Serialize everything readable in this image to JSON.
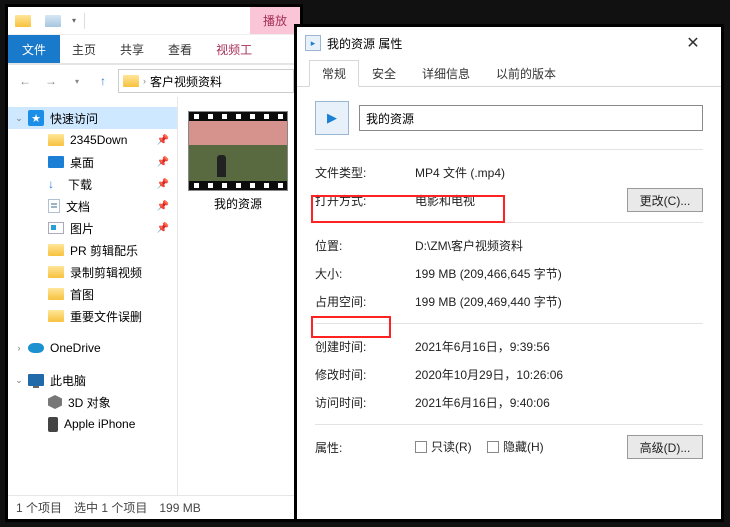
{
  "explorer": {
    "ribbon": {
      "file": "文件",
      "home": "主页",
      "share": "共享",
      "view": "查看",
      "video": "视频工",
      "play": "播放"
    },
    "breadcrumb": "客户视频资料",
    "tree": {
      "quick_access": "快速访问",
      "items": [
        {
          "label": "2345Down",
          "icon": "folder"
        },
        {
          "label": "桌面",
          "icon": "desktop"
        },
        {
          "label": "下载",
          "icon": "download"
        },
        {
          "label": "文档",
          "icon": "doc"
        },
        {
          "label": "图片",
          "icon": "pic"
        },
        {
          "label": "PR 剪辑配乐",
          "icon": "folder"
        },
        {
          "label": "录制剪辑视频",
          "icon": "folder"
        },
        {
          "label": "首图",
          "icon": "folder"
        },
        {
          "label": "重要文件误删",
          "icon": "folder"
        }
      ],
      "onedrive": "OneDrive",
      "this_pc": "此电脑",
      "pc_items": [
        {
          "label": "3D 对象",
          "icon": "3d"
        },
        {
          "label": "Apple iPhone",
          "icon": "iphone"
        }
      ]
    },
    "file_name": "我的资源",
    "status": {
      "count": "1 个项目",
      "selection": "选中 1 个项目",
      "size": "199 MB"
    }
  },
  "props": {
    "title": "我的资源 属性",
    "tabs": {
      "general": "常规",
      "security": "安全",
      "details": "详细信息",
      "previous": "以前的版本"
    },
    "name_value": "我的资源",
    "rows": {
      "type_label": "文件类型:",
      "type_value": "MP4 文件 (.mp4)",
      "open_label": "打开方式:",
      "open_value": "电影和电视",
      "change_btn": "更改(C)...",
      "loc_label": "位置:",
      "loc_value": "D:\\ZM\\客户视频资料",
      "size_label": "大小:",
      "size_value": "199 MB (209,466,645 字节)",
      "disk_label": "占用空间:",
      "disk_value": "199 MB (209,469,440 字节)",
      "created_label": "创建时间:",
      "created_value": "2021年6月16日，9:39:56",
      "modified_label": "修改时间:",
      "modified_value": "2020年10月29日，10:26:06",
      "accessed_label": "访问时间:",
      "accessed_value": "2021年6月16日，9:40:06",
      "attr_label": "属性:",
      "readonly": "只读(R)",
      "hidden": "隐藏(H)",
      "advanced_btn": "高级(D)..."
    }
  }
}
